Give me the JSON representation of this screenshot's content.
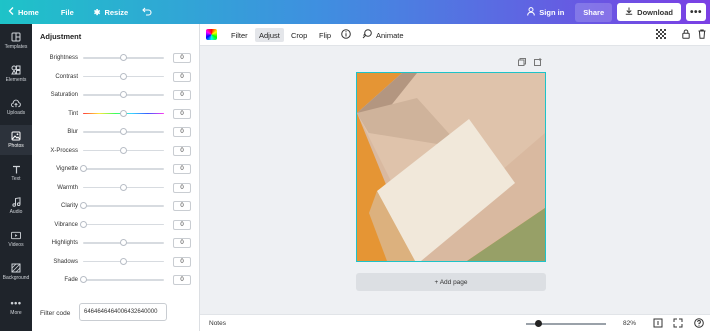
{
  "topbar": {
    "home": "Home",
    "file": "File",
    "resize": "Resize",
    "sign_in": "Sign in",
    "share": "Share",
    "download": "Download"
  },
  "sidebar": {
    "items": [
      {
        "label": "Templates",
        "icon": "templates-icon"
      },
      {
        "label": "Elements",
        "icon": "elements-icon"
      },
      {
        "label": "Uploads",
        "icon": "uploads-icon"
      },
      {
        "label": "Photos",
        "icon": "photos-icon"
      },
      {
        "label": "Text",
        "icon": "text-icon"
      },
      {
        "label": "Audio",
        "icon": "audio-icon"
      },
      {
        "label": "Videos",
        "icon": "videos-icon"
      },
      {
        "label": "Background",
        "icon": "background-icon"
      },
      {
        "label": "More",
        "icon": "more-icon"
      }
    ]
  },
  "panel": {
    "title": "Adjustment",
    "adjustments": [
      {
        "label": "Brightness",
        "value": "0",
        "level": 0.5
      },
      {
        "label": "Contrast",
        "value": "0",
        "level": 0.5
      },
      {
        "label": "Saturation",
        "value": "0",
        "level": 0.5
      },
      {
        "label": "Tint",
        "value": "0",
        "level": 0.5
      },
      {
        "label": "Blur",
        "value": "0",
        "level": 0.5
      },
      {
        "label": "X-Process",
        "value": "0",
        "level": 0.5
      },
      {
        "label": "Vignette",
        "value": "0",
        "level": 0.0
      },
      {
        "label": "Warmth",
        "value": "0",
        "level": 0.5
      },
      {
        "label": "Clarity",
        "value": "0",
        "level": 0.0
      },
      {
        "label": "Vibrance",
        "value": "0",
        "level": 0.0
      },
      {
        "label": "Highlights",
        "value": "0",
        "level": 0.5
      },
      {
        "label": "Shadows",
        "value": "0",
        "level": 0.5
      },
      {
        "label": "Fade",
        "value": "0",
        "level": 0.0
      }
    ],
    "filter_code_label": "Filter code",
    "filter_code_value": "6464646464006432640000"
  },
  "toolbar": {
    "filter": "Filter",
    "adjust": "Adjust",
    "crop": "Crop",
    "flip": "Flip",
    "animate": "Animate"
  },
  "canvas": {
    "add_page": "+ Add page"
  },
  "bottombar": {
    "notes": "Notes",
    "zoom": "82%",
    "zoom_level": 0.15
  },
  "colors": {
    "accent": "#1ec3c8",
    "sidebar_bg": "#1f242b",
    "gradient_start": "#1ec3c8",
    "gradient_end": "#7b3fe4"
  }
}
